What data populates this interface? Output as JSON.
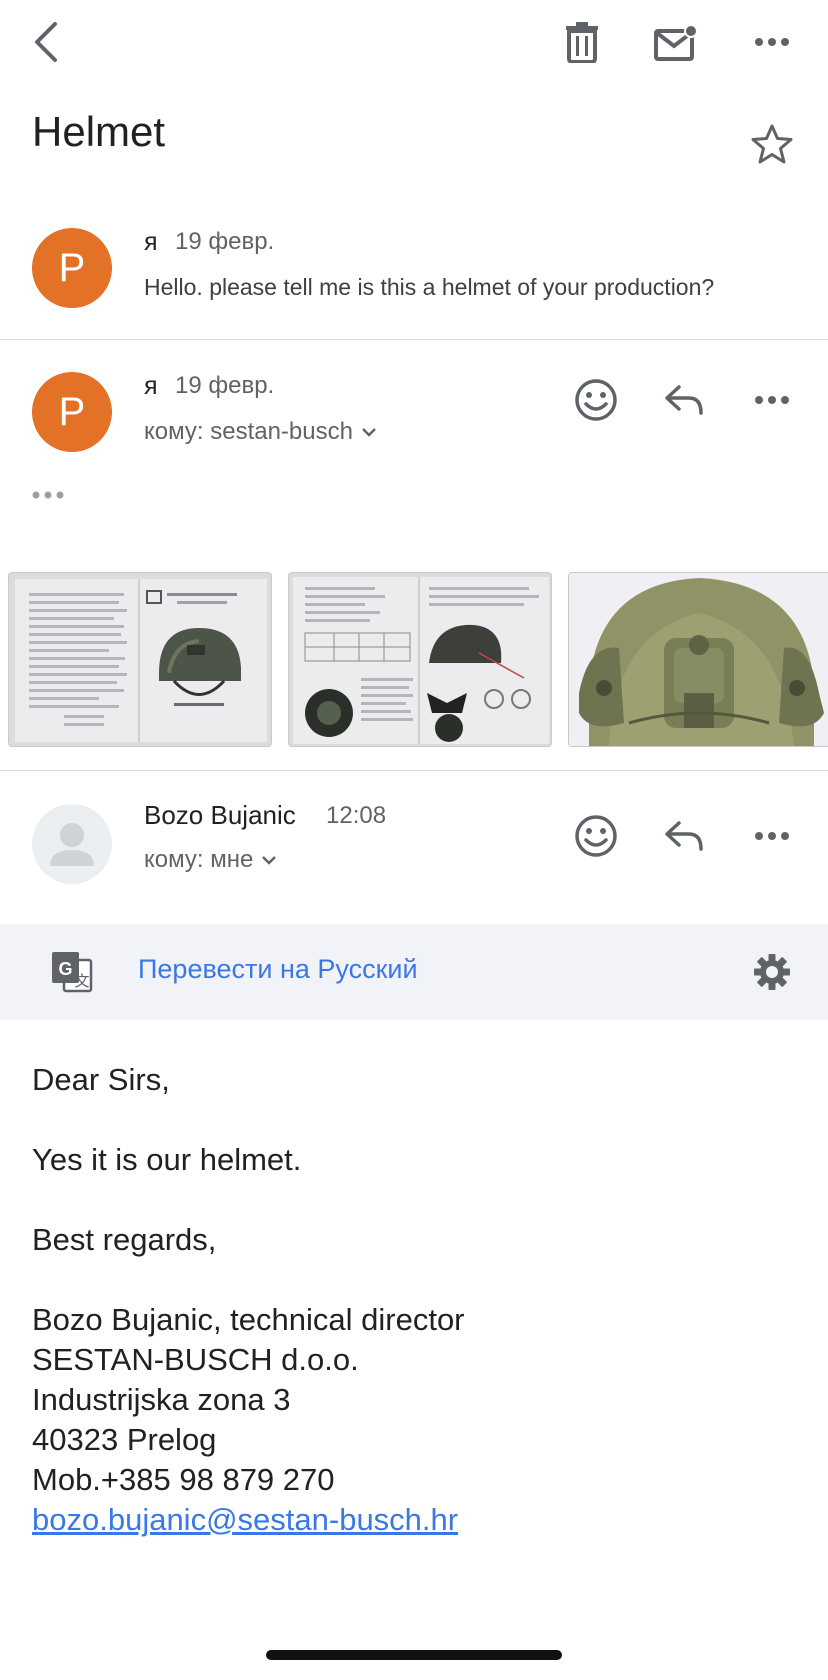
{
  "subject": "Helmet",
  "messages": [
    {
      "avatar_letter": "P",
      "sender": "я",
      "date": "19 февр.",
      "snippet": "Hello. please tell me is this a helmet of your production?"
    },
    {
      "avatar_letter": "P",
      "sender": "я",
      "date": "19 февр.",
      "to": "кому: sestan-busch",
      "attachments": [
        "user-manual-page-1",
        "user-manual-page-2",
        "helmet-photo"
      ]
    },
    {
      "sender": "Bozo Bujanic",
      "time": "12:08",
      "to": "кому: мне"
    }
  ],
  "translate": {
    "label": "Перевести на Русский"
  },
  "body": {
    "greeting": "Dear Sirs,",
    "line1": "Yes it is our helmet.",
    "closing": "Best regards,",
    "sig_name": "Bozo Bujanic, technical director",
    "sig_company": "SESTAN-BUSCH d.o.o.",
    "sig_address1": "Industrijska zona 3",
    "sig_address2": "40323 Prelog",
    "sig_mobile": "Mob.+385 98 879 270",
    "sig_email": "bozo.bujanic@sestan-busch.hr"
  },
  "colors": {
    "avatar": "#e37126",
    "link": "#3b78e7",
    "translate_bg": "#f1f3f9"
  }
}
